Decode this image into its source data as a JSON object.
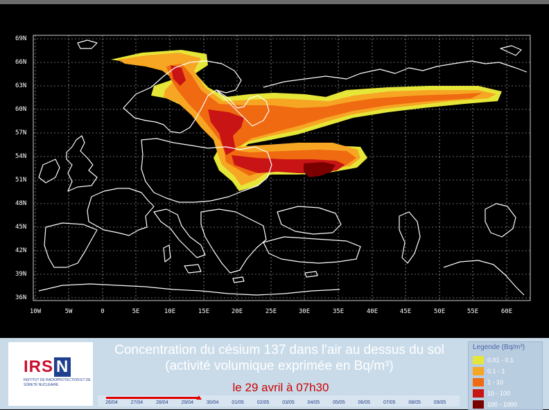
{
  "map": {
    "lat_labels": [
      "69N",
      "66N",
      "63N",
      "60N",
      "57N",
      "54N",
      "51N",
      "48N",
      "45N",
      "42N",
      "39N",
      "36N"
    ],
    "lon_labels": [
      "10W",
      "5W",
      "0",
      "5E",
      "10E",
      "15E",
      "20E",
      "25E",
      "30E",
      "35E",
      "40E",
      "45E",
      "50E",
      "55E",
      "60E"
    ],
    "colors": {
      "bin1": "#e6e639",
      "bin2": "#f6a623",
      "bin3": "#ef6a10",
      "bin4": "#c81414",
      "bin5": "#7a0000",
      "coast": "#ffffff",
      "grid": "#cfcfcf"
    }
  },
  "panel": {
    "logo": {
      "name": "IRSN",
      "sub": "Institut de radioprotection et de sûreté nucléaire"
    },
    "title_line1": "Concentration du césium 137 dans l'air au dessus du sol",
    "title_line2": "(activité volumique exprimée en Bq/m³)",
    "date_text": "le  29 avril  à  07h30",
    "timeline": {
      "dates": [
        "26/04",
        "27/04",
        "28/04",
        "29/04",
        "30/04",
        "01/05",
        "02/05",
        "03/05",
        "04/05",
        "05/05",
        "06/05",
        "07/05",
        "08/05",
        "09/05"
      ],
      "progress_fraction": 0.27
    },
    "legend": {
      "title": "Legende (Bq/m³)",
      "items": [
        {
          "label": "0.01 - 0.1",
          "color": "#e6e639"
        },
        {
          "label": "0.1 - 1",
          "color": "#f6a623"
        },
        {
          "label": "1 - 10",
          "color": "#ef6a10"
        },
        {
          "label": "10 - 100",
          "color": "#c81414"
        },
        {
          "label": "100 - 1000",
          "color": "#7a0000"
        }
      ]
    }
  }
}
